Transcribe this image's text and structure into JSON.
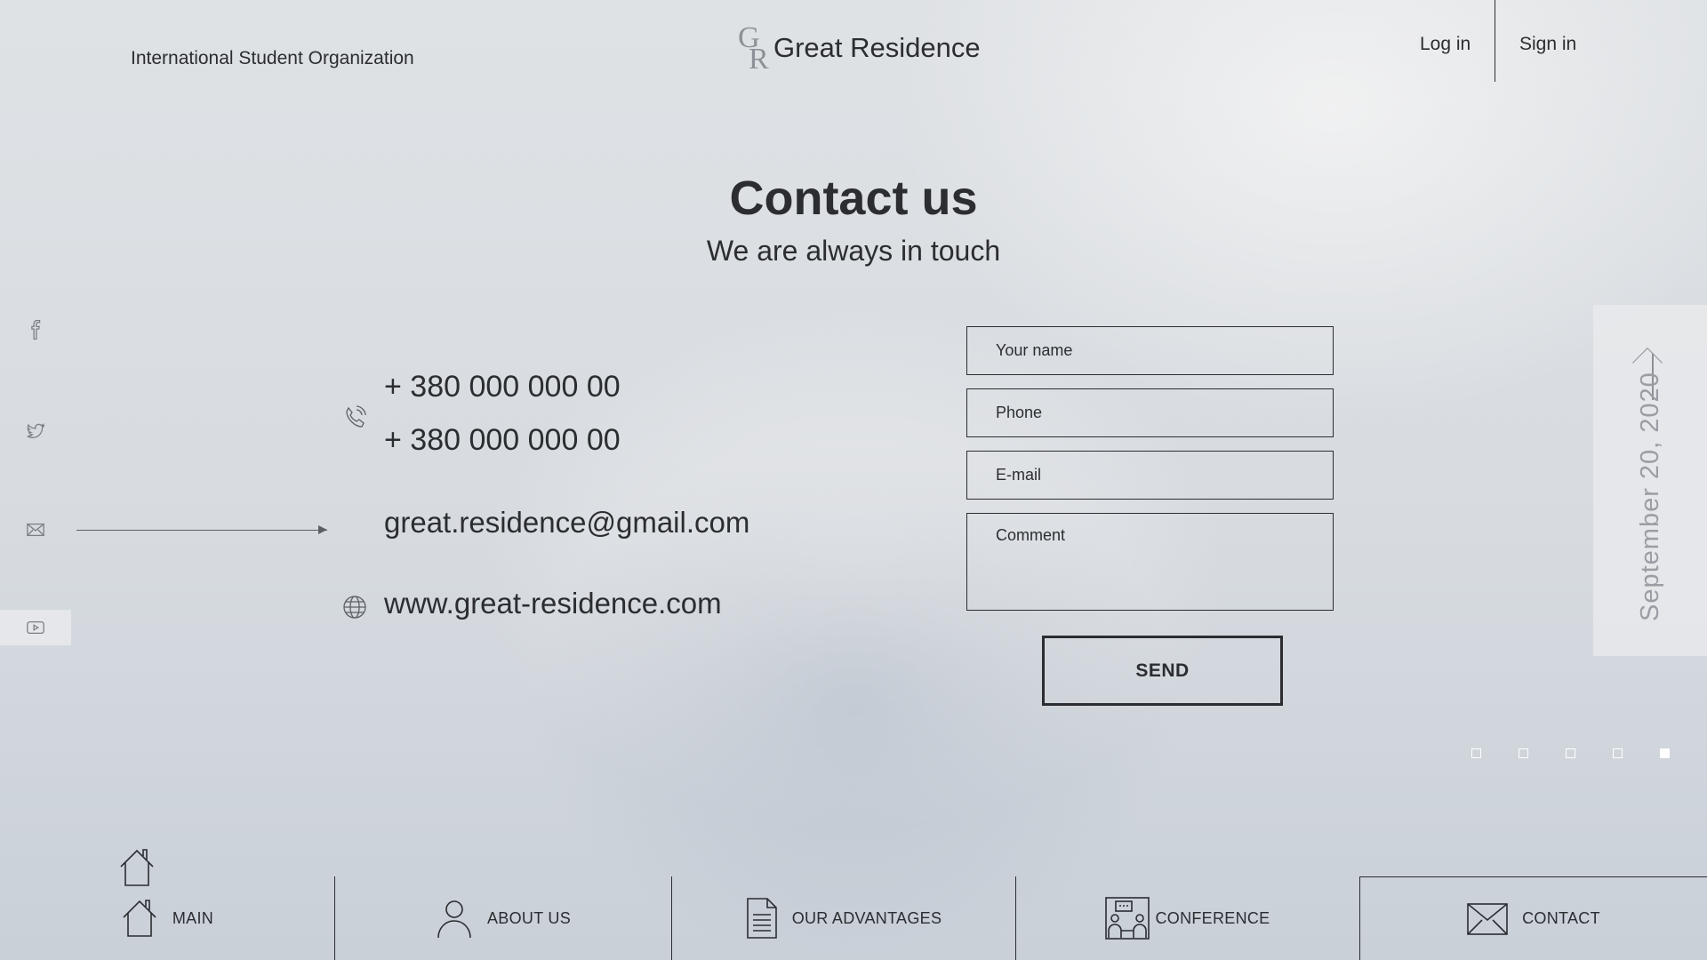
{
  "header": {
    "organization": "International Student Organization",
    "logo_mark_top": "G",
    "logo_mark_bottom": "R",
    "logo_text": "Great Residence",
    "login_label": "Log in",
    "signin_label": "Sign in"
  },
  "hero": {
    "title": "Contact us",
    "subtitle": "We are always in touch"
  },
  "social": {
    "icons": [
      "facebook-icon",
      "twitter-icon",
      "mail-icon",
      "youtube-icon"
    ]
  },
  "contacts": {
    "phone_1": "+ 380 000 000 00",
    "phone_2": "+ 380 000 000 00",
    "email": "great.residence@gmail.com",
    "website": "www.great-residence.com"
  },
  "form": {
    "name_placeholder": "Your name",
    "phone_placeholder": "Phone",
    "email_placeholder": "E-mail",
    "comment_placeholder": "Comment",
    "send_label": "SEND"
  },
  "date_panel": {
    "date": "September 20, 2020"
  },
  "pager": {
    "count": 5,
    "active_index": 4
  },
  "nav": {
    "items": [
      {
        "label": "MAIN",
        "icon": "home-icon"
      },
      {
        "label": "ABOUT US",
        "icon": "user-icon"
      },
      {
        "label": "OUR ADVANTAGES",
        "icon": "document-icon"
      },
      {
        "label": "CONFERENCE",
        "icon": "conference-icon"
      },
      {
        "label": "CONTACT",
        "icon": "envelope-icon"
      }
    ],
    "active_index": 4
  },
  "colors": {
    "text": "#2b2d31",
    "muted": "#9a9ea4",
    "dot": "#ffffff"
  }
}
